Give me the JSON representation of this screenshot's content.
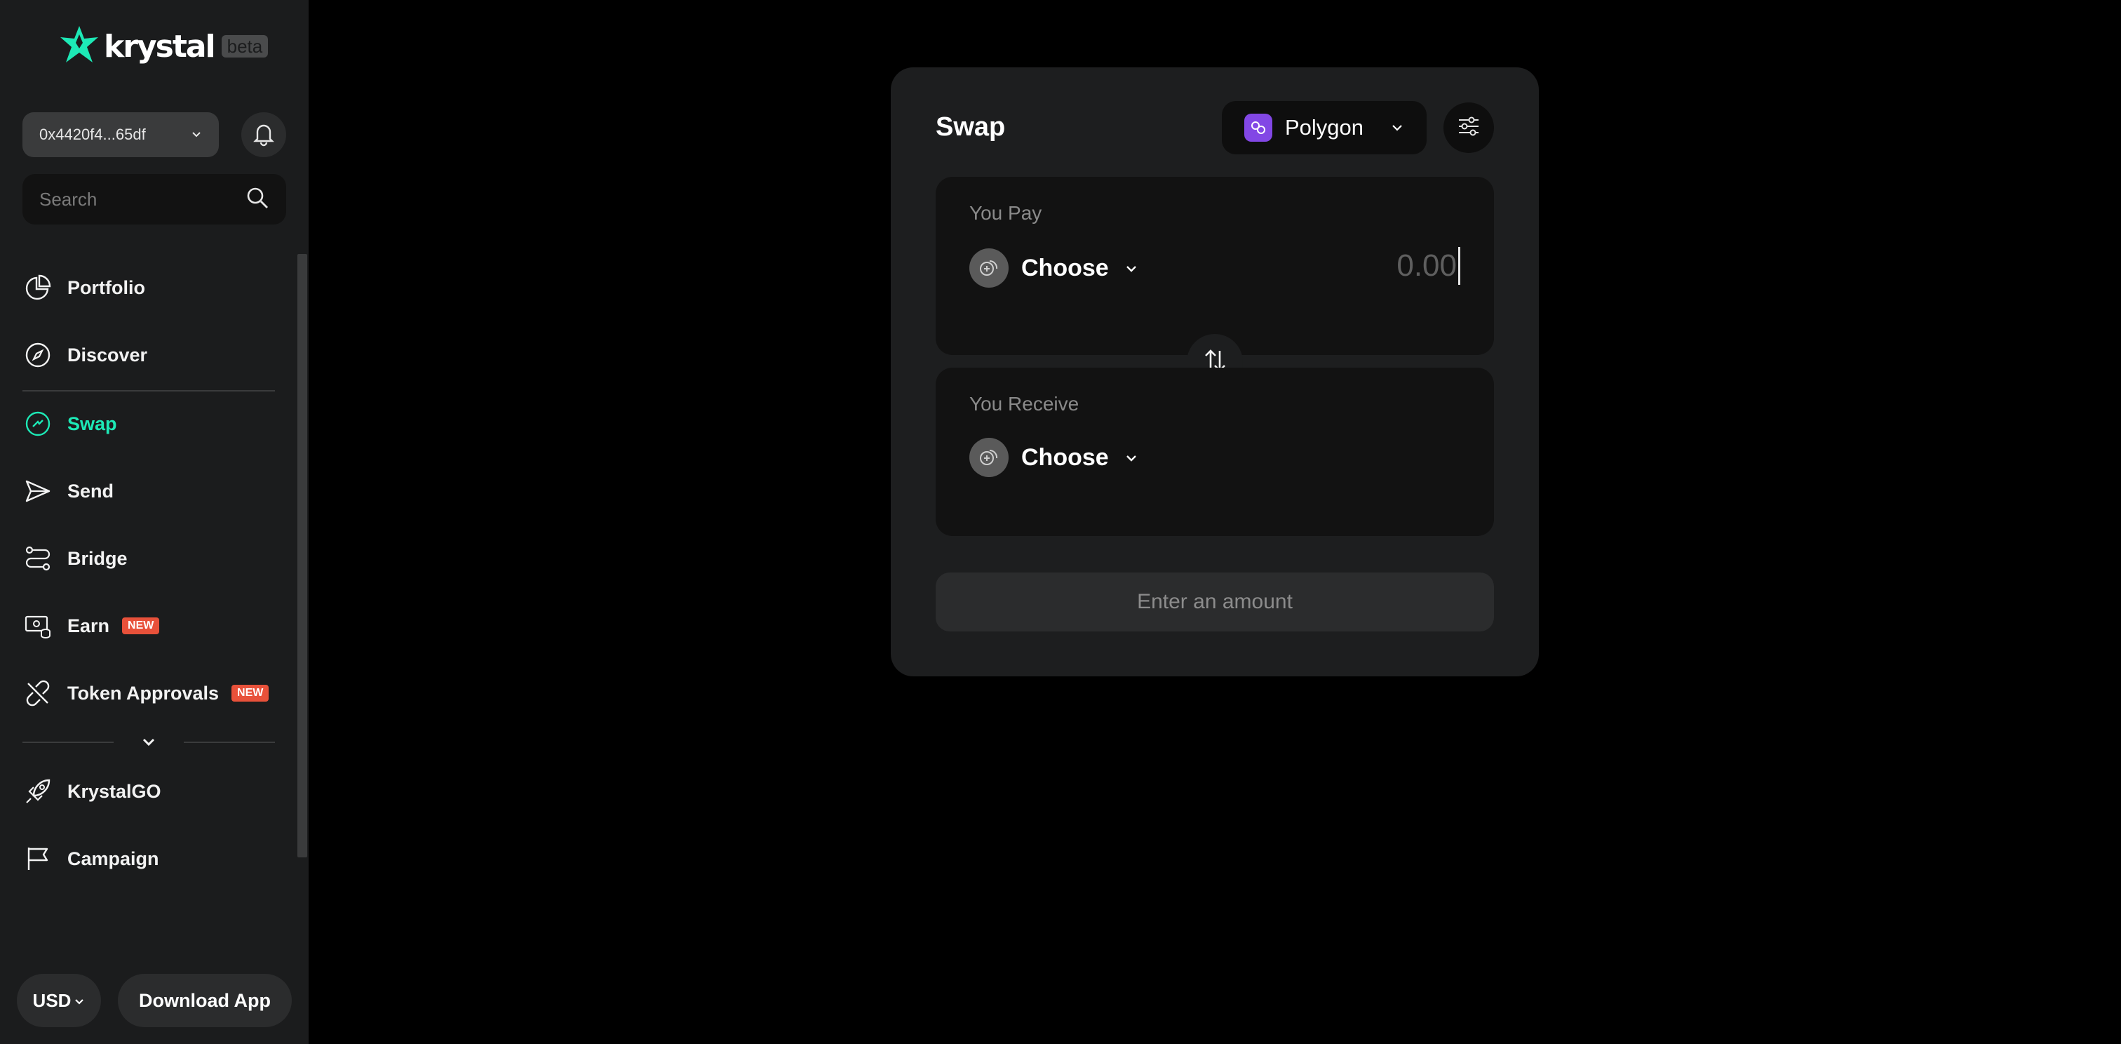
{
  "brand": {
    "name": "krystal",
    "badge": "beta",
    "accent": "#1de9b6"
  },
  "sidebar": {
    "wallet_address": "0x4420f4...65df",
    "search_placeholder": "Search",
    "items": [
      {
        "label": "Portfolio",
        "icon": "portfolio-icon"
      },
      {
        "label": "Discover",
        "icon": "compass-icon"
      },
      {
        "label": "Swap",
        "icon": "swap-icon",
        "active": true
      },
      {
        "label": "Send",
        "icon": "send-icon"
      },
      {
        "label": "Bridge",
        "icon": "bridge-icon"
      },
      {
        "label": "Earn",
        "icon": "earn-icon",
        "badge": "NEW"
      },
      {
        "label": "Token Approvals",
        "icon": "approvals-icon",
        "badge": "NEW"
      },
      {
        "label": "KrystalGO",
        "icon": "rocket-icon"
      },
      {
        "label": "Campaign",
        "icon": "flag-icon"
      }
    ],
    "currency": "USD",
    "download_label": "Download App"
  },
  "swap": {
    "title": "Swap",
    "network": "Polygon",
    "network_color": "#8247e5",
    "pay": {
      "label": "You Pay",
      "token": "Choose",
      "amount_placeholder": "0.00"
    },
    "receive": {
      "label": "You Receive",
      "token": "Choose"
    },
    "action_label": "Enter an amount"
  }
}
